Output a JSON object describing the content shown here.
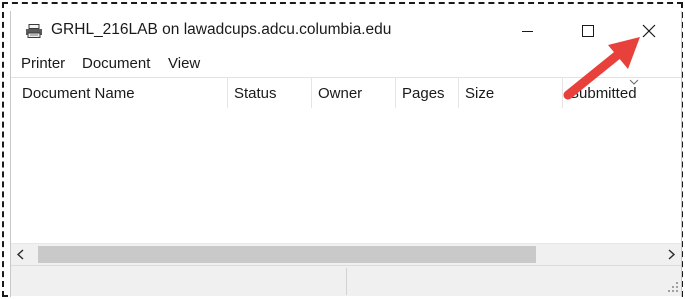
{
  "window": {
    "title": "GRHL_216LAB on lawadcups.adcu.columbia.edu",
    "icon": "printer-icon",
    "controls": {
      "minimize": "minimize-icon",
      "maximize": "maximize-icon",
      "close": "close-icon"
    }
  },
  "menu": {
    "items": [
      "Printer",
      "Document",
      "View"
    ]
  },
  "list": {
    "columns": [
      "Document Name",
      "Status",
      "Owner",
      "Pages",
      "Size",
      "Submitted"
    ],
    "rows": []
  },
  "scrollbar": {
    "left_arrow": "<",
    "right_arrow": ">"
  },
  "annotation": {
    "arrow_color": "#e8403a",
    "points_to": "close-icon"
  },
  "colors": {
    "chrome": "#f0f0f0",
    "scroll_thumb": "#c9c9c9",
    "arrow": "#e8403a"
  }
}
